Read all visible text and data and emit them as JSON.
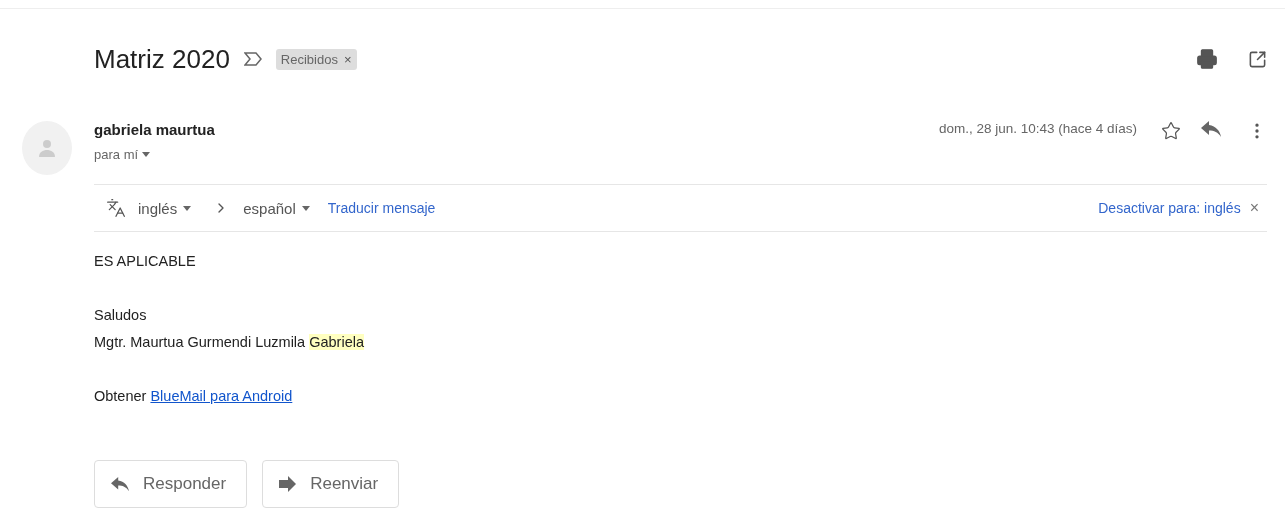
{
  "subject": {
    "title": "Matriz 2020",
    "important": false,
    "labels": [
      {
        "text": "Recibidos",
        "remove": "×"
      }
    ]
  },
  "message": {
    "sender": "gabriela maurtua",
    "recipient": "para mí",
    "date": "dom., 28 jun. 10:43 (hace 4 días)",
    "starred": false
  },
  "translate_bar": {
    "from": "inglés",
    "to": "español",
    "action": "Traducir mensaje",
    "disable": "Desactivar para: inglés",
    "close": "×"
  },
  "body": [
    {
      "lines": [
        {
          "kind": "text",
          "text": "ES APLICABLE"
        }
      ]
    },
    {
      "lines": [
        {
          "kind": "text",
          "text": "Saludos"
        },
        {
          "kind": "highlight",
          "text": "Mgtr. Maurtua Gurmendi Luzmila",
          "highlighted": "Gabriela"
        }
      ]
    },
    {
      "lines": [
        {
          "kind": "link",
          "text": "Obtener",
          "link": "BlueMail para Android"
        }
      ]
    }
  ],
  "actions": [
    {
      "kind": "reply",
      "label": "Responder"
    },
    {
      "kind": "forward",
      "label": "Reenviar"
    }
  ]
}
